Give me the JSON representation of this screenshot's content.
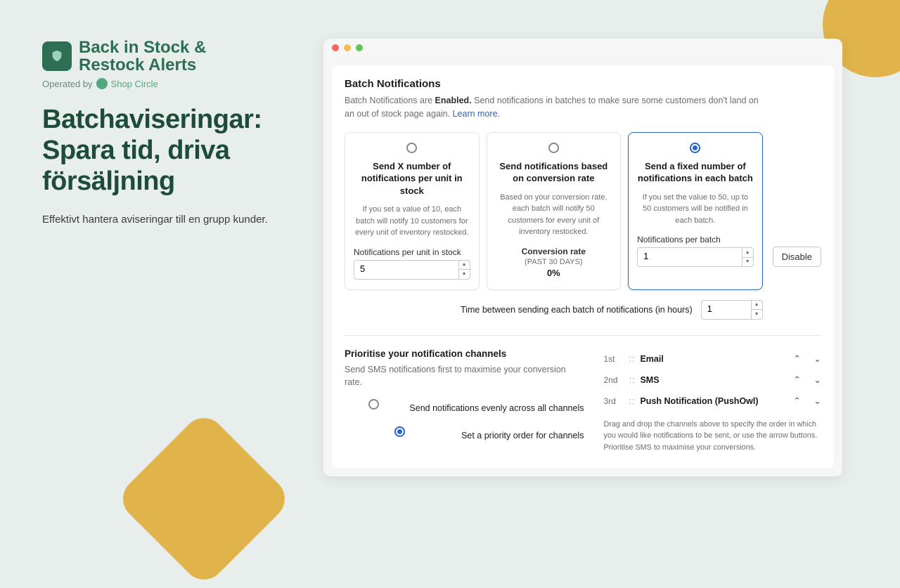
{
  "brand": {
    "name_line1": "Back in Stock &",
    "name_line2": "Restock Alerts",
    "operated_prefix": "Operated by",
    "operator": "Shop Circle"
  },
  "marketing": {
    "headline": "Batchaviseringar: Spara tid, driva försäljning",
    "sub": "Effektivt hantera aviseringar till en grupp kunder."
  },
  "panel": {
    "title": "Batch Notifications",
    "desc_pre": "Batch Notifications are ",
    "desc_bold": "Enabled.",
    "desc_post": " Send notifications in batches to make sure some customers don't land on an out of stock page again. ",
    "learn_more": "Learn more.",
    "disable_label": "Disable",
    "options": [
      {
        "title": "Send X number of notifications per unit in stock",
        "desc": "If you set a value of 10, each batch will notify 10 customers for every unit of inventory restocked.",
        "field_label": "Notifications per unit in stock",
        "value": "5",
        "selected": false,
        "has_input": true
      },
      {
        "title": "Send notifications based on conversion rate",
        "desc": "Based on your conversion rate, each batch will notify 50 customers for every unit of inventory restocked.",
        "conv_label": "Conversion rate",
        "conv_sub": "(PAST 30 DAYS)",
        "conv_val": "0%",
        "selected": false,
        "has_input": false
      },
      {
        "title": "Send a fixed number of notifications in each batch",
        "desc": "If you set the value to 50, up to 50 customers will be notified in each batch.",
        "field_label": "Notifications per batch",
        "value": "1",
        "selected": true,
        "has_input": true
      }
    ],
    "time_label": "Time between sending each batch of notifications (in hours)",
    "time_value": "1"
  },
  "priority": {
    "title": "Prioritise your notification channels",
    "sub": "Send SMS notifications first to maximise your conversion rate.",
    "choices": [
      {
        "label": "Send notifications evenly across all channels",
        "selected": false
      },
      {
        "label": "Set a priority order for channels",
        "selected": true
      }
    ],
    "channels": [
      {
        "order": "1st",
        "name": "Email"
      },
      {
        "order": "2nd",
        "name": "SMS"
      },
      {
        "order": "3rd",
        "name": "Push Notification (PushOwl)"
      }
    ],
    "hint": "Drag and drop the channels above to specify the order in which you would like notifications to be sent, or use the arrow buttons. Prioritise SMS to maximise your conversions."
  }
}
